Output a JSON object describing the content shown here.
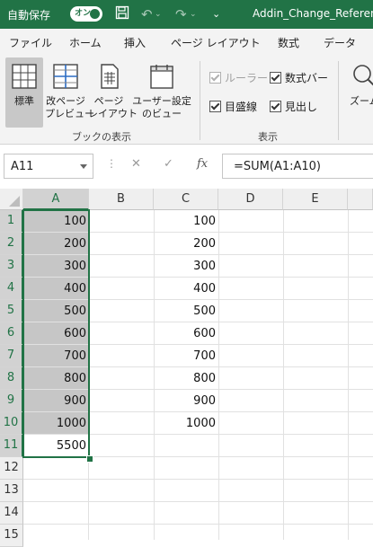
{
  "titlebar": {
    "autosave_label": "自動保存",
    "toggle_label": "オン",
    "filename": "Addin_Change_Referen"
  },
  "tabs": [
    "ファイル",
    "ホーム",
    "挿入",
    "ページ レイアウト",
    "数式",
    "データ"
  ],
  "ribbon": {
    "view_buttons": [
      {
        "line1": "標準",
        "line2": ""
      },
      {
        "line1": "改ページ",
        "line2": "プレビュー"
      },
      {
        "line1": "ページ",
        "line2": "レイアウト"
      },
      {
        "line1": "ユーザー設定",
        "line2": "のビュー"
      }
    ],
    "group_book_views": "ブックの表示",
    "group_show": "表示",
    "ruler": "ルーラー",
    "formula_bar": "数式バー",
    "gridlines": "目盛線",
    "headings": "見出し",
    "zoom": "ズーム"
  },
  "formula_bar": {
    "name_box": "A11",
    "fx": "fx",
    "formula": "=SUM(A1:A10)"
  },
  "grid": {
    "columns": [
      "A",
      "B",
      "C",
      "D",
      "E"
    ],
    "rows": [
      "1",
      "2",
      "3",
      "4",
      "5",
      "6",
      "7",
      "8",
      "9",
      "10",
      "11",
      "12",
      "13",
      "14",
      "15"
    ],
    "colA": [
      "100",
      "200",
      "300",
      "400",
      "500",
      "600",
      "700",
      "800",
      "900",
      "1000",
      "5500"
    ],
    "colC": [
      "100",
      "200",
      "300",
      "400",
      "500",
      "600",
      "700",
      "800",
      "900",
      "1000"
    ]
  },
  "colors": {
    "accent": "#217346",
    "selection": "#c6c6c6"
  }
}
